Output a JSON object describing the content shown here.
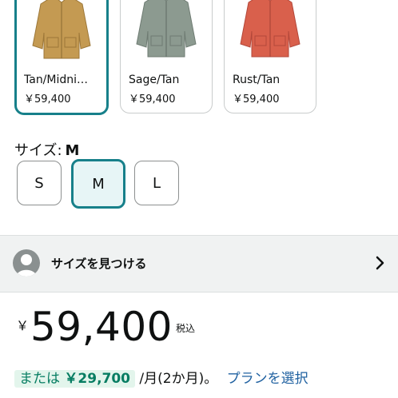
{
  "colors": [
    {
      "label": "Tan/Midni…",
      "price": "￥59,400",
      "swatch": "#c49a52",
      "selected": true
    },
    {
      "label": "Sage/Tan",
      "price": "￥59,400",
      "swatch": "#8c9a90",
      "selected": false
    },
    {
      "label": "Rust/Tan",
      "price": "￥59,400",
      "swatch": "#d9604c",
      "selected": false
    }
  ],
  "size": {
    "heading": "サイズ:",
    "selected_value": "M",
    "options": [
      "S",
      "M",
      "L"
    ]
  },
  "find_size": {
    "label": "サイズを見つける",
    "icon": "user-avatar-icon",
    "chevron": "chevron-right-icon"
  },
  "price": {
    "currency": "￥",
    "amount": "59,400",
    "tax_note": "税込"
  },
  "installment": {
    "prefix": "または",
    "amount": "￥29,700",
    "suffix": "/月(2か月)。",
    "link": "プランを選択"
  },
  "accent_color": "#17808a",
  "link_color": "#2162a1"
}
